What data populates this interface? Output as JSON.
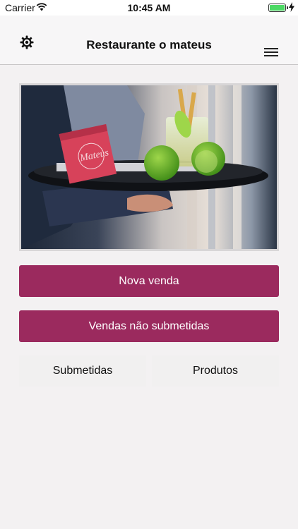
{
  "status_bar": {
    "carrier": "Carrier",
    "time": "10:45 AM",
    "battery_color": "#4cd964"
  },
  "nav": {
    "title": "Restaurante o mateus",
    "left_icon": "gear-icon",
    "right_icon": "menu-icon"
  },
  "hero": {
    "image": "waiter-tray-photo",
    "box_text": "Mateus"
  },
  "actions": {
    "nova_venda": "Nova venda",
    "vendas_nao_submetidas": "Vendas não submetidas",
    "submetidas": "Submetidas",
    "produtos": "Produtos"
  },
  "colors": {
    "primary": "#9b2a5e",
    "background": "#f3f1f2"
  }
}
